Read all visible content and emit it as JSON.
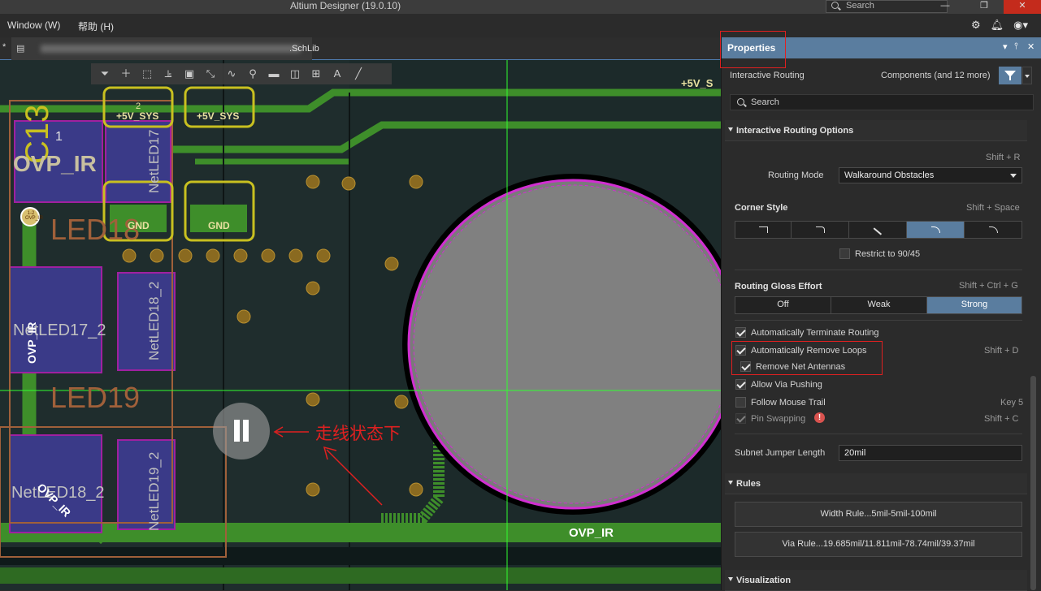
{
  "titlebar": {
    "app_title": "Altium Designer (19.0.10)",
    "search_label": "Search",
    "minimize": "—",
    "restore": "❐",
    "close": "✕"
  },
  "menubar": {
    "window": "Window (W)",
    "help": "帮助 (H)"
  },
  "tabs": {
    "document": ".SchLib",
    "modified_marker": "*"
  },
  "canvas": {
    "labels": {
      "c13": "C13",
      "ovp_ir_big": "OVP_IR",
      "led18": "LED18",
      "led19": "LED19",
      "net_led17": "NetLED17_2",
      "net_led18": "NetLED18_2",
      "net_led19": "NetLED19_2",
      "net_led17_short": "NetLED17",
      "net_led18_left": "NetLED18_2",
      "ovp_vert": "OVP_IR",
      "ovp_diag": "OVP_IR",
      "ovp_bottom": "OVP_IR",
      "plus5v_a": "+5V_SYS",
      "plus5v_b": "+5V_SYS",
      "plus5v_right": "+5V_S",
      "gnd_a": "GND",
      "gnd_b": "GND",
      "pad1": "1",
      "pad2": "2",
      "pad_net": "1-2",
      "pad_net_label": "OVP_IR",
      "annotation": "走线状态下"
    }
  },
  "panel": {
    "title": "Properties",
    "mode": "Interactive Routing",
    "filter_text": "Components (and 12 more)",
    "search_placeholder": "Search",
    "sections": {
      "routing_options": "Interactive Routing Options",
      "rules": "Rules",
      "visualization": "Visualization"
    },
    "shortcut_routing_mode": "Shift + R",
    "routing_mode_label": "Routing Mode",
    "routing_mode_value": "Walkaround Obstacles",
    "corner_style_label": "Corner Style",
    "corner_style_shortcut": "Shift + Space",
    "restrict_label": "Restrict to 90/45",
    "gloss_label": "Routing Gloss Effort",
    "gloss_shortcut": "Shift + Ctrl + G",
    "gloss_options": [
      "Off",
      "Weak",
      "Strong"
    ],
    "gloss_selected": "Strong",
    "checks": {
      "auto_terminate": "Automatically Terminate Routing",
      "auto_remove_loops": "Automatically Remove Loops",
      "auto_remove_loops_shortcut": "Shift + D",
      "remove_antennas": "Remove Net Antennas",
      "allow_via_push": "Allow Via Pushing",
      "follow_mouse": "Follow Mouse Trail",
      "follow_mouse_shortcut": "Key 5",
      "pin_swapping": "Pin Swapping",
      "pin_swapping_shortcut": "Shift + C"
    },
    "subnet_label": "Subnet Jumper Length",
    "subnet_value": "20mil",
    "rule_width": "Width Rule...5mil-5mil-100mil",
    "rule_via": "Via Rule...19.685mil/11.811mil-78.74mil/39.37mil",
    "pin_icon": "▾",
    "dock_icon": "⫯",
    "close_icon": "✕"
  },
  "colors": {
    "accent": "#5a7d9f",
    "highlight": "#e02020",
    "trace_green": "#3e8e2a",
    "board": "#1c2a2a"
  }
}
